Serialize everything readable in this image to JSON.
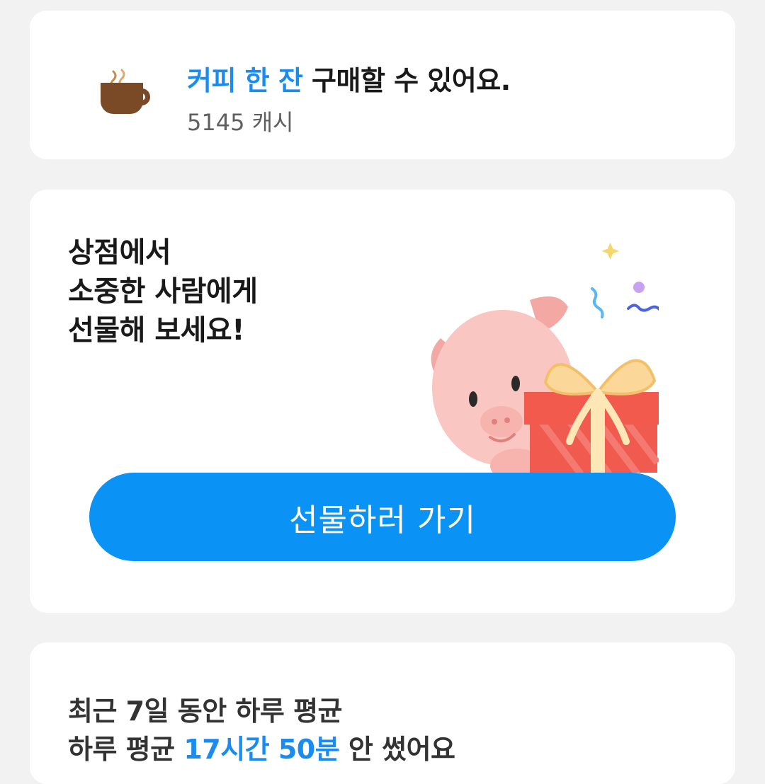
{
  "coffee_card": {
    "icon": "coffee-cup-icon",
    "title_highlight": "커피 한 잔",
    "title_rest": " 구매할 수 있어요.",
    "balance": "5145 캐시"
  },
  "gift_card": {
    "lines": [
      "상점에서",
      "소중한 사람에게",
      "선물해 보세요!"
    ],
    "illustration": "pig-with-gift-box",
    "button_label": "선물하러 가기"
  },
  "usage_card": {
    "line1": "최근 7일 동안 하루 평균",
    "line2_prefix": "하루 평균 ",
    "line2_highlight": "17시간 50분",
    "line2_suffix": " 안 썼어요"
  },
  "colors": {
    "accent": "#1a8cf0",
    "button": "#0a93f5",
    "background": "#f2f2f2",
    "card": "#ffffff"
  }
}
